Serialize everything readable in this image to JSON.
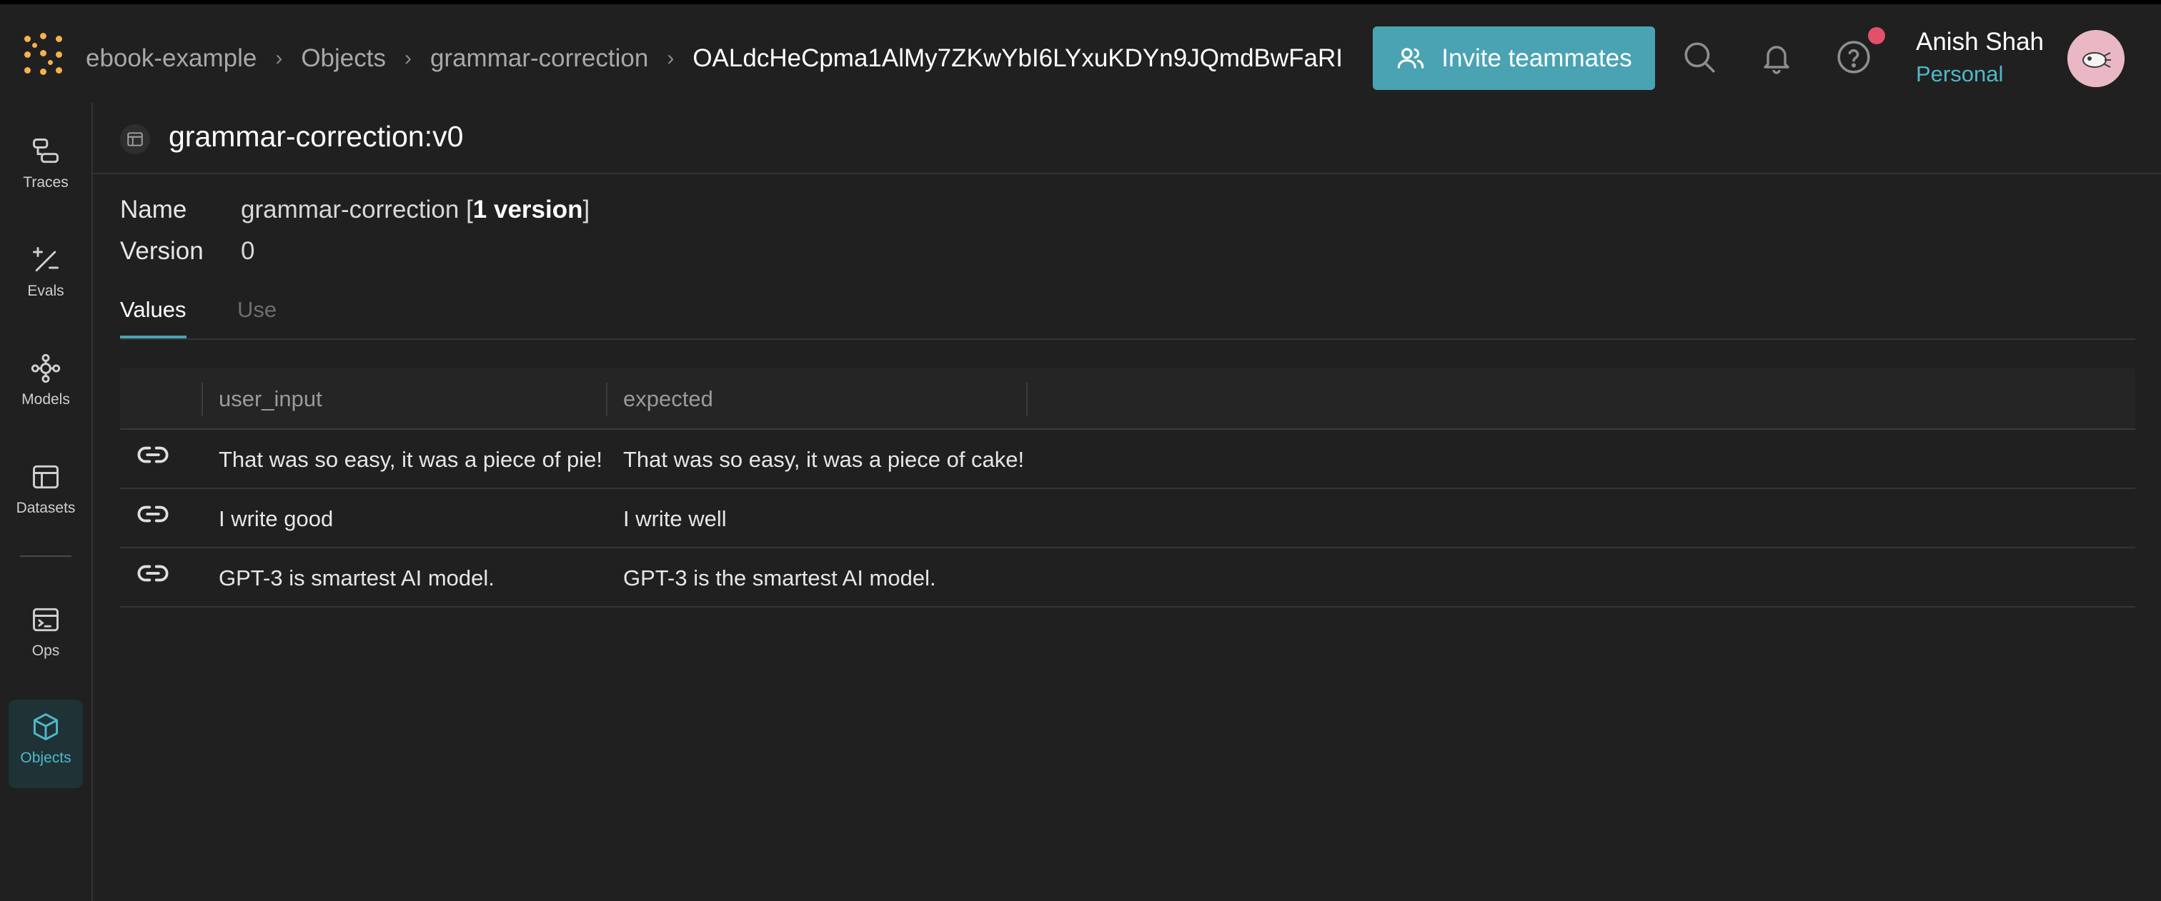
{
  "breadcrumb": {
    "items": [
      "ebook-example",
      "Objects",
      "grammar-correction",
      "OALdcHeCpma1AlMy7ZKwYbI6LYxuKDYn9JQmdBwFaRI"
    ]
  },
  "header": {
    "invite_label": "Invite teammates",
    "user_name": "Anish Shah",
    "user_org": "Personal"
  },
  "sidebar": {
    "items": [
      {
        "label": "Traces",
        "icon": "traces-icon"
      },
      {
        "label": "Evals",
        "icon": "evals-icon"
      },
      {
        "label": "Models",
        "icon": "models-icon"
      },
      {
        "label": "Datasets",
        "icon": "datasets-icon"
      },
      {
        "label": "Ops",
        "icon": "ops-icon"
      },
      {
        "label": "Objects",
        "icon": "objects-icon"
      }
    ]
  },
  "page": {
    "title": "grammar-correction:v0",
    "meta": {
      "name_label": "Name",
      "name_value": "grammar-correction [",
      "name_versions": "1 version",
      "name_close": "]",
      "version_label": "Version",
      "version_value": "0"
    },
    "tabs": [
      "Values",
      "Use"
    ]
  },
  "table": {
    "columns": [
      "user_input",
      "expected"
    ],
    "rows": [
      {
        "user_input": "That was so easy, it was a piece of pie!",
        "expected": "That was so easy, it was a piece of cake!"
      },
      {
        "user_input": "I write good",
        "expected": "I write well"
      },
      {
        "user_input": "GPT-3 is smartest AI model.",
        "expected": "GPT-3 is the smartest AI model."
      }
    ]
  },
  "colors": {
    "accent": "#4aa3b3",
    "logo": "#f5b14a",
    "notification": "#e2506a",
    "background": "#202020"
  }
}
